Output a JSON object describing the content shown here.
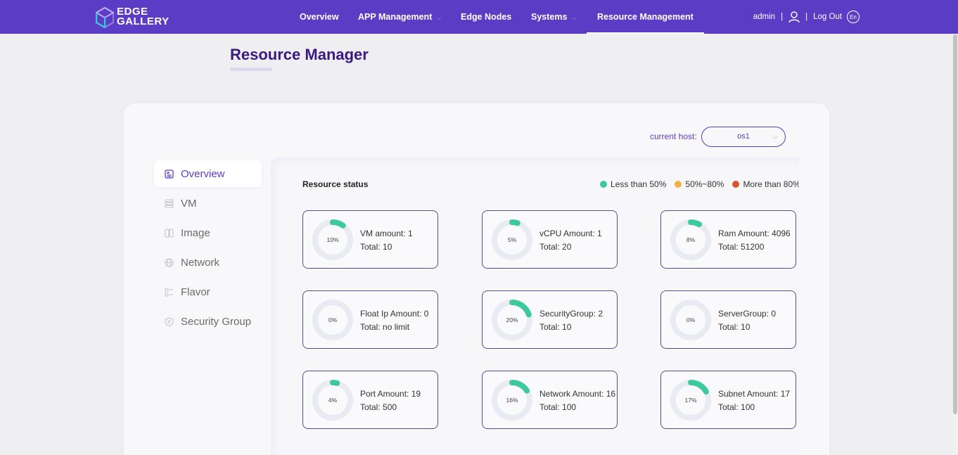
{
  "brand": {
    "line1": "EDGE",
    "line2": "GALLERY"
  },
  "nav": {
    "items": [
      {
        "label": "Overview",
        "caret": false,
        "active": false
      },
      {
        "label": "APP Management",
        "caret": true,
        "active": false
      },
      {
        "label": "Edge Nodes",
        "caret": false,
        "active": false
      },
      {
        "label": "Systems",
        "caret": true,
        "active": false
      },
      {
        "label": "Resource Management",
        "caret": false,
        "active": true
      }
    ],
    "user": "admin",
    "separator": "|",
    "logout": "Log Out",
    "lang": "En"
  },
  "page": {
    "title": "Resource Manager"
  },
  "host": {
    "label": "current host:",
    "value": "os1"
  },
  "sidebar": {
    "items": [
      {
        "label": "Overview",
        "icon": "overview-icon",
        "active": true
      },
      {
        "label": "VM",
        "icon": "vm-icon",
        "active": false
      },
      {
        "label": "Image",
        "icon": "image-icon",
        "active": false
      },
      {
        "label": "Network",
        "icon": "network-icon",
        "active": false
      },
      {
        "label": "Flavor",
        "icon": "flavor-icon",
        "active": false
      },
      {
        "label": "Security Group",
        "icon": "security-group-icon",
        "active": false
      }
    ]
  },
  "status": {
    "title": "Resource status",
    "legend": [
      {
        "label": "Less than 50%",
        "color": "#3ec99a"
      },
      {
        "label": "50%~80%",
        "color": "#f2b144"
      },
      {
        "label": "More than 80%",
        "color": "#d9542c"
      }
    ]
  },
  "colors": {
    "accent": "#5b3cc4",
    "ring_bg": "#e8ebf2",
    "ring_ok": "#3ec99a"
  },
  "resources": [
    {
      "name": "VM amount: 1",
      "total": "Total: 10",
      "percent": 10,
      "pct_label": "10%"
    },
    {
      "name": "vCPU Amount: 1",
      "total": "Total: 20",
      "percent": 5,
      "pct_label": "5%"
    },
    {
      "name": "Ram Amount: 4096",
      "total": "Total: 51200",
      "percent": 8,
      "pct_label": "8%"
    },
    {
      "name": "Float Ip Amount: 0",
      "total": "Total: no limit",
      "percent": 0,
      "pct_label": "0%"
    },
    {
      "name": "SecurityGroup: 2",
      "total": "Total: 10",
      "percent": 20,
      "pct_label": "20%"
    },
    {
      "name": "ServerGroup: 0",
      "total": "Total: 10",
      "percent": 0,
      "pct_label": "0%"
    },
    {
      "name": "Port Amount: 19",
      "total": "Total: 500",
      "percent": 4,
      "pct_label": "4%"
    },
    {
      "name": "Network Amount: 16",
      "total": "Total: 100",
      "percent": 16,
      "pct_label": "16%"
    },
    {
      "name": "Subnet Amount: 17",
      "total": "Total: 100",
      "percent": 17,
      "pct_label": "17%"
    }
  ]
}
